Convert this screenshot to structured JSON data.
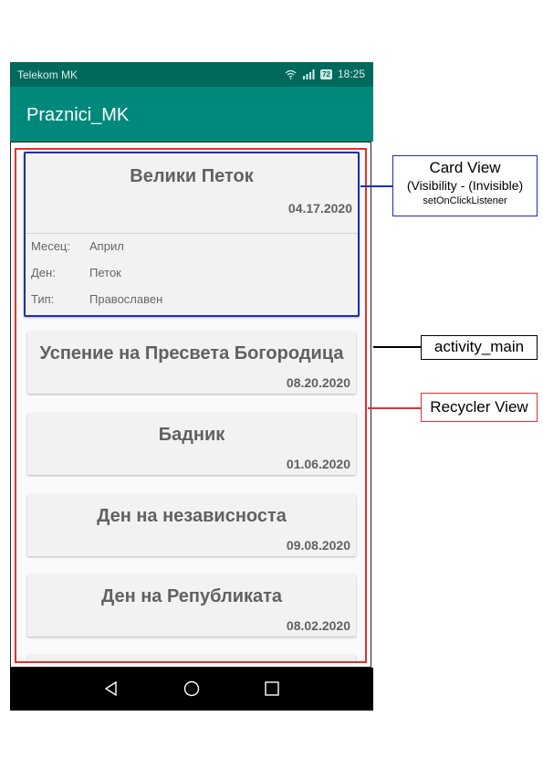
{
  "status_bar": {
    "carrier": "Telekom MK",
    "battery": "72",
    "time": "18:25"
  },
  "app_bar": {
    "title": "Praznici_MK"
  },
  "expanded_card": {
    "title": "Велики Петок",
    "date": "04.17.2020",
    "details": [
      {
        "key": "Месец:",
        "value": "Април"
      },
      {
        "key": "Ден:",
        "value": "Петок"
      },
      {
        "key": "Тип:",
        "value": "Православен"
      }
    ]
  },
  "cards": [
    {
      "title": "Успение на Пресвета Богородица",
      "date": "08.20.2020"
    },
    {
      "title": "Бадник",
      "date": "01.06.2020"
    },
    {
      "title": "Ден на независноста",
      "date": "09.08.2020"
    },
    {
      "title": "Ден на Републиката",
      "date": "08.02.2020"
    }
  ],
  "annotations": {
    "card_view": {
      "line1": "Card View",
      "line2": "(Visibility - (Invisible)",
      "line3": "setOnClickListener",
      "color": "#1a2fb5"
    },
    "activity_main": {
      "label": "activity_main",
      "color": "#000000"
    },
    "recycler_view": {
      "label": "Recycler View",
      "color": "#e5302b"
    }
  },
  "colors": {
    "status_bar": "#00695c",
    "app_bar": "#00897b",
    "card_bg": "#f2f2f2",
    "text": "#616161"
  },
  "icons": [
    "wifi-icon",
    "signal-icon",
    "battery-icon",
    "back-icon",
    "home-icon",
    "recents-icon"
  ]
}
